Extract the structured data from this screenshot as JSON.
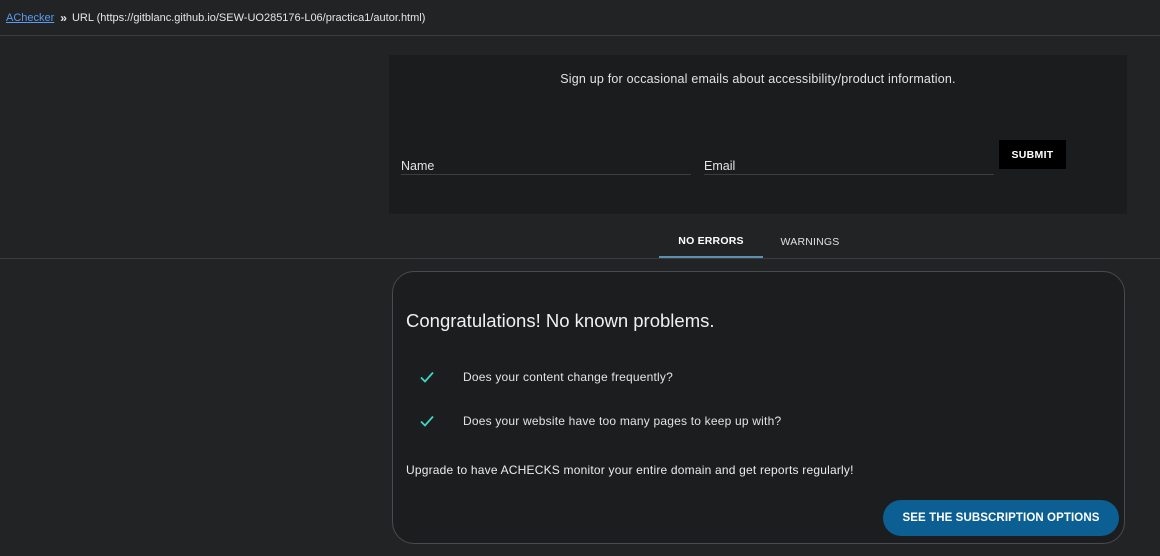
{
  "breadcrumb": {
    "link": "AChecker",
    "separator": "»",
    "url_text": "URL (https://gitblanc.github.io/SEW-UO285176-L06/practica1/autor.html)"
  },
  "signup": {
    "text": "Sign up for occasional emails about accessibility/product information.",
    "name_placeholder": "Name",
    "email_placeholder": "Email",
    "submit_label": "SUBMIT"
  },
  "tabs": {
    "no_errors": "NO ERRORS",
    "warnings": "WARNINGS"
  },
  "result": {
    "title": "Congratulations! No known problems.",
    "checks": [
      "Does your content change frequently?",
      "Does your website have too many pages to keep up with?"
    ],
    "upgrade_text": "Upgrade to have ACHECKS monitor your entire domain and get reports regularly!",
    "cta_label": "SEE THE SUBSCRIPTION OPTIONS"
  },
  "colors": {
    "background": "#222325",
    "check": "#3ed6c4",
    "cta": "#0b5f93",
    "link": "#5b9cf0"
  },
  "icons": {
    "check": "check-icon"
  }
}
